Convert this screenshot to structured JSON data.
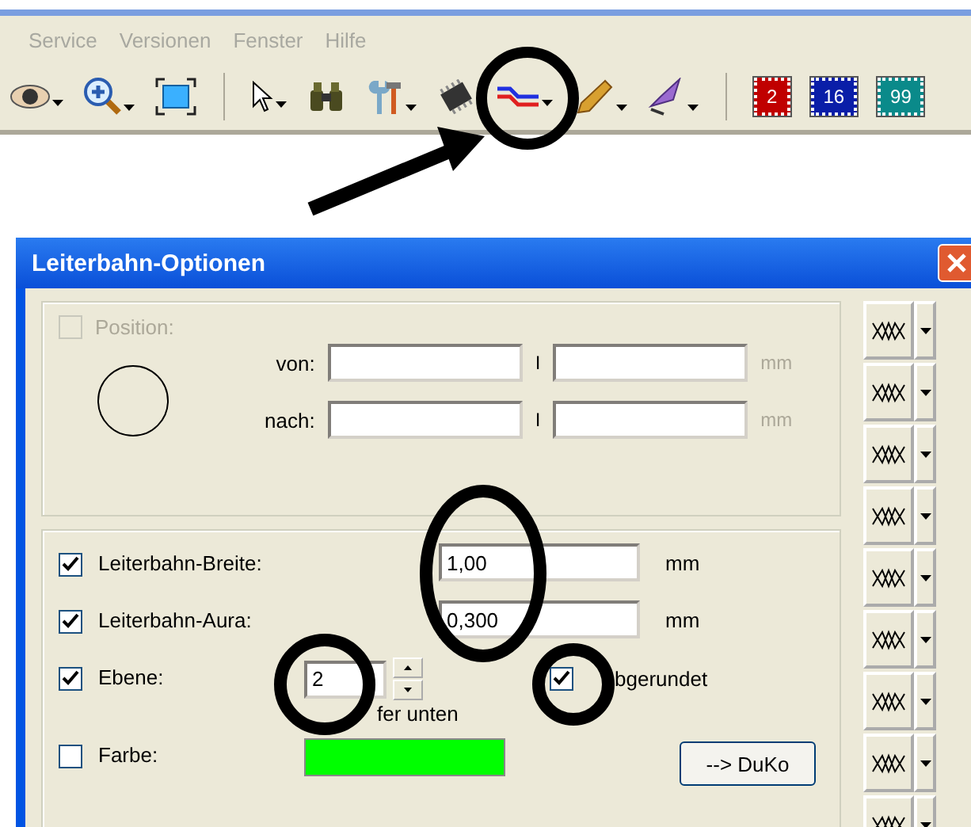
{
  "menu": [
    "Service",
    "Versionen",
    "Fenster",
    "Hilfe"
  ],
  "toolbar": [
    {
      "kind": "eye",
      "dropdown": true
    },
    {
      "kind": "zoom",
      "dropdown": true
    },
    {
      "kind": "fit",
      "dropdown": false
    },
    {
      "kind": "separator"
    },
    {
      "kind": "pointer",
      "dropdown": true
    },
    {
      "kind": "binoculars",
      "dropdown": false
    },
    {
      "kind": "tools",
      "dropdown": true
    },
    {
      "kind": "chip",
      "dropdown": false
    },
    {
      "kind": "traces",
      "dropdown": true
    },
    {
      "kind": "pen",
      "dropdown": true
    },
    {
      "kind": "hat",
      "dropdown": true
    },
    {
      "kind": "separator"
    },
    {
      "kind": "badge",
      "text": "2",
      "color": "#c00000"
    },
    {
      "kind": "badge",
      "text": "16",
      "color": "#0a1ea8"
    },
    {
      "kind": "badge",
      "text": "99",
      "color": "#0a8a8a"
    }
  ],
  "dialog": {
    "title": "Leiterbahn-Optionen",
    "position": {
      "label": "Position:",
      "checked": false,
      "disabled": true,
      "rows": [
        {
          "label": "von:",
          "separator": "I",
          "unit": "mm"
        },
        {
          "label": "nach:",
          "separator": "I",
          "unit": "mm"
        }
      ]
    },
    "options": [
      {
        "kind": "field",
        "label": "Leiterbahn-Breite:",
        "checked": true,
        "value": "1,00",
        "unit": "mm"
      },
      {
        "kind": "field",
        "label": "Leiterbahn-Aura:",
        "checked": true,
        "value": "0,300",
        "unit": "mm"
      },
      {
        "kind": "spinner",
        "label": "Ebene:",
        "checked": true,
        "value": "2",
        "note": "fer unten",
        "extra_label": "bgerundet",
        "extra_checked": true
      },
      {
        "kind": "color",
        "label": "Farbe:",
        "checked": false,
        "color": "#00ff00",
        "button": "--> DuKo"
      }
    ],
    "side_buttons": [
      {
        "dropdown": true
      },
      {
        "dropdown": true
      },
      {
        "dropdown": true
      },
      {
        "dropdown": true
      },
      {
        "dropdown": true
      },
      {
        "dropdown": true
      },
      {
        "dropdown": true
      },
      {
        "dropdown": true
      },
      {
        "dropdown": true
      }
    ]
  }
}
